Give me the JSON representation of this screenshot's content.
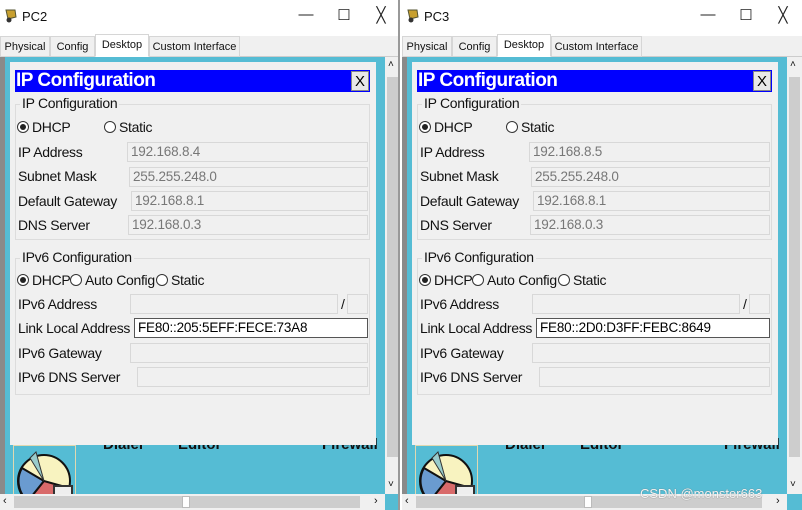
{
  "windows": [
    {
      "title": "PC2",
      "tabs": [
        "Physical",
        "Config",
        "Desktop",
        "Custom Interface"
      ],
      "active_tab": "Desktop",
      "dialog": {
        "title": "IP Configuration",
        "close": "X",
        "ipv4": {
          "group": "IP Configuration",
          "dhcp": "DHCP",
          "static": "Static",
          "mode": "DHCP",
          "ip_label": "IP Address",
          "ip": "192.168.8.4",
          "mask_label": "Subnet Mask",
          "mask": "255.255.248.0",
          "gw_label": "Default Gateway",
          "gw": "192.168.8.1",
          "dns_label": "DNS Server",
          "dns": "192.168.0.3"
        },
        "ipv6": {
          "group": "IPv6 Configuration",
          "dhcp": "DHCP",
          "auto": "Auto Config",
          "static": "Static",
          "mode": "DHCP",
          "addr_label": "IPv6 Address",
          "addr": "",
          "slash": "/",
          "prefix": "",
          "lla_label": "Link Local Address",
          "lla": "FE80::205:5EFF:FECE:73A8",
          "gw_label": "IPv6 Gateway",
          "gw": "",
          "dns_label": "IPv6 DNS Server",
          "dns": ""
        }
      },
      "apps": [
        "Dialer",
        "Editor",
        "Firewall"
      ]
    },
    {
      "title": "PC3",
      "tabs": [
        "Physical",
        "Config",
        "Desktop",
        "Custom Interface"
      ],
      "active_tab": "Desktop",
      "dialog": {
        "title": "IP Configuration",
        "close": "X",
        "ipv4": {
          "group": "IP Configuration",
          "dhcp": "DHCP",
          "static": "Static",
          "mode": "DHCP",
          "ip_label": "IP Address",
          "ip": "192.168.8.5",
          "mask_label": "Subnet Mask",
          "mask": "255.255.248.0",
          "gw_label": "Default Gateway",
          "gw": "192.168.8.1",
          "dns_label": "DNS Server",
          "dns": "192.168.0.3"
        },
        "ipv6": {
          "group": "IPv6 Configuration",
          "dhcp": "DHCP",
          "auto": "Auto Config",
          "static": "Static",
          "mode": "DHCP",
          "addr_label": "IPv6 Address",
          "addr": "",
          "slash": "/",
          "prefix": "",
          "lla_label": "Link Local Address",
          "lla": "FE80::2D0:D3FF:FEBC:8649",
          "gw_label": "IPv6 Gateway",
          "gw": "",
          "dns_label": "IPv6 DNS Server",
          "dns": ""
        }
      },
      "apps": [
        "Dialer",
        "Editor",
        "Firewall"
      ]
    }
  ],
  "window_controls": {
    "minimize": "—",
    "maximize": "☐",
    "close": "╳"
  },
  "watermark": "CSDN @monster663",
  "colors": {
    "header_blue": "#0000ff",
    "desktop_teal": "#55bcd4"
  }
}
